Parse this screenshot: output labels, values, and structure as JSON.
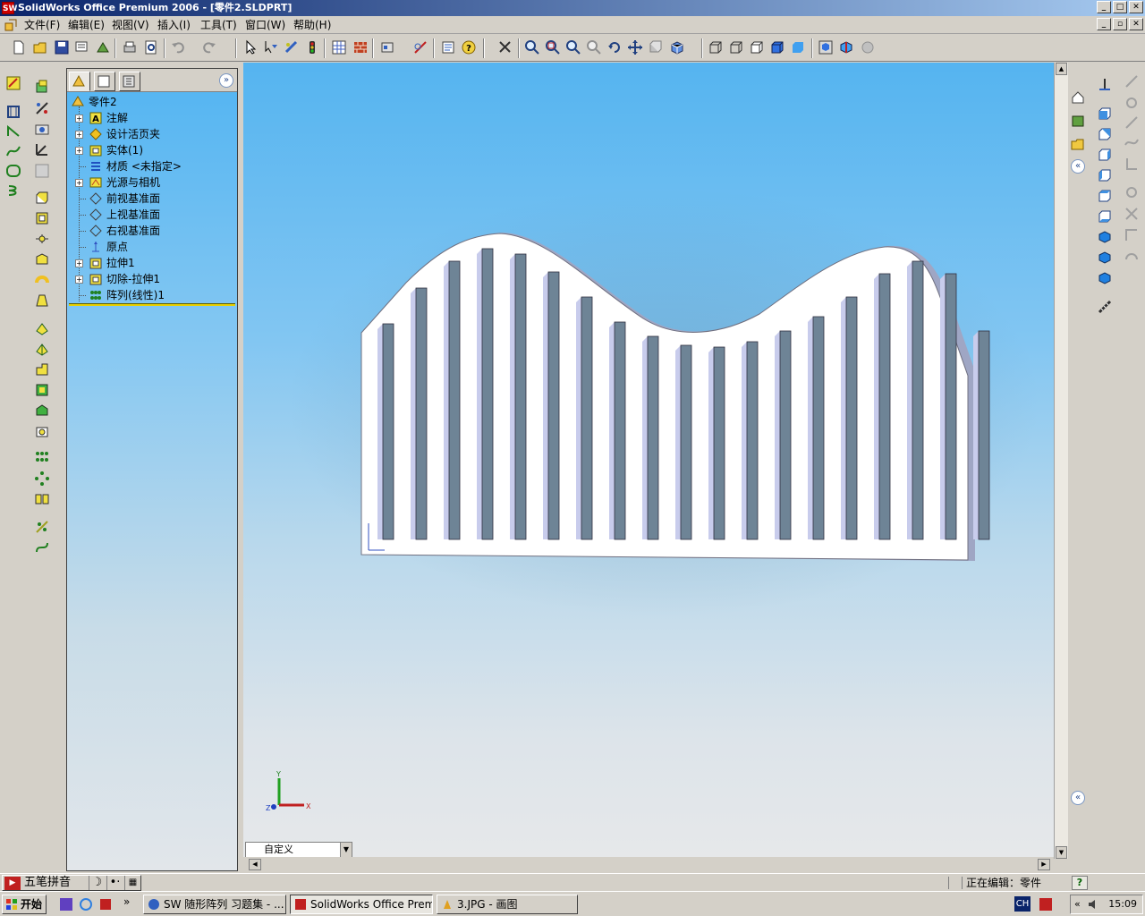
{
  "window": {
    "title": "SolidWorks Office Premium 2006 - [零件2.SLDPRT]",
    "logo_text": "SW",
    "minimize": "_",
    "maximize": "□",
    "close": "✕",
    "mdi_restore": "▫"
  },
  "menu": {
    "items": [
      "文件(F)",
      "编辑(E)",
      "视图(V)",
      "插入(I)",
      "工具(T)",
      "窗口(W)",
      "帮助(H)"
    ]
  },
  "feature_tree": {
    "expand_glyph": "»",
    "root": "零件2",
    "items": [
      {
        "label": "注解",
        "icon": "annotation-icon",
        "expandable": true
      },
      {
        "label": "设计活页夹",
        "icon": "design-binder-icon",
        "expandable": true
      },
      {
        "label": "实体(1)",
        "icon": "solid-body-icon",
        "expandable": true
      },
      {
        "label": "材质 <未指定>",
        "icon": "material-icon",
        "expandable": false
      },
      {
        "label": "光源与相机",
        "icon": "lights-camera-icon",
        "expandable": true
      },
      {
        "label": "前视基准面",
        "icon": "plane-icon",
        "expandable": false
      },
      {
        "label": "上视基准面",
        "icon": "plane-icon",
        "expandable": false
      },
      {
        "label": "右视基准面",
        "icon": "plane-icon",
        "expandable": false
      },
      {
        "label": "原点",
        "icon": "origin-icon",
        "expandable": false
      },
      {
        "label": "拉伸1",
        "icon": "extrude-icon",
        "expandable": true
      },
      {
        "label": "切除-拉伸1",
        "icon": "cut-extrude-icon",
        "expandable": true
      },
      {
        "label": "阵列(线性)1",
        "icon": "linear-pattern-icon",
        "expandable": false
      }
    ]
  },
  "viewport": {
    "configuration": "自定义",
    "triad": {
      "y": "Y",
      "x": "X",
      "z": "Z"
    }
  },
  "status": {
    "editing": "正在编辑：零件",
    "help": "?"
  },
  "ime": {
    "name": "五笔拼音"
  },
  "taskbar": {
    "start": "开始",
    "overflow": "»",
    "tasks": [
      {
        "label": "SW 随形阵列 习题集 - ...",
        "active": false
      },
      {
        "label": "SolidWorks Office Premiu...",
        "active": true
      },
      {
        "label": "3.JPG - 画图",
        "active": false
      }
    ],
    "lang": "CH",
    "tray_chevron": "«",
    "clock": "15:09"
  },
  "colors": {
    "title_start": "#0a246a",
    "title_end": "#a6caf0",
    "viewport_top": "#55b4f0",
    "viewport_bottom": "#e6e8ea",
    "rollback_bar": "#e8d000"
  }
}
